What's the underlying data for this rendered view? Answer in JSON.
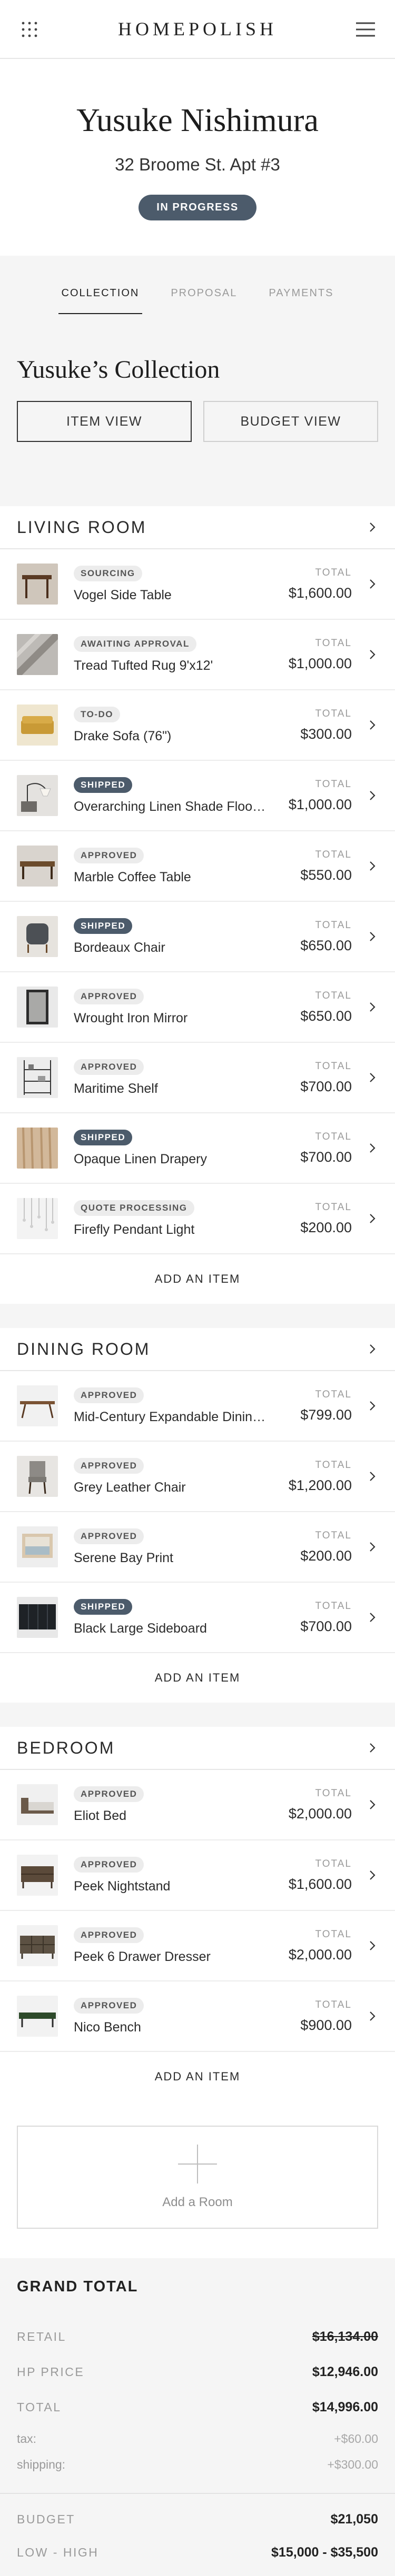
{
  "app": {
    "brand": "HOMEPOLISH"
  },
  "project": {
    "client_name": "Yusuke Nishimura",
    "address": "32 Broome St. Apt #3",
    "status": "IN PROGRESS"
  },
  "tabs": [
    {
      "label": "COLLECTION",
      "active": true
    },
    {
      "label": "PROPOSAL",
      "active": false
    },
    {
      "label": "PAYMENTS",
      "active": false
    }
  ],
  "collection": {
    "title": "Yusuke’s Collection",
    "item_view_label": "ITEM VIEW",
    "budget_view_label": "BUDGET VIEW"
  },
  "labels": {
    "total": "TOTAL",
    "add_item": "ADD AN ITEM",
    "add_room": "Add a Room"
  },
  "colors": {
    "status_badge": "#4c5b6b",
    "page_gray": "#f5f5f5",
    "light_badge": "#ececec"
  },
  "rooms": [
    {
      "name": "LIVING ROOM",
      "items": [
        {
          "status": "SOURCING",
          "name": "Vogel Side Table",
          "total": "$1,600.00",
          "thumb": "side-table"
        },
        {
          "status": "AWAITING APPROVAL",
          "name": "Tread Tufted Rug 9'x12'",
          "total": "$1,000.00",
          "thumb": "rug"
        },
        {
          "status": "TO-DO",
          "name": "Drake Sofa (76\")",
          "total": "$300.00",
          "thumb": "sofa"
        },
        {
          "status": "SHIPPED",
          "name": "Overarching Linen Shade Floor Lamp",
          "total": "$1,000.00",
          "thumb": "floor-lamp"
        },
        {
          "status": "APPROVED",
          "name": "Marble Coffee Table",
          "total": "$550.00",
          "thumb": "coffee-table"
        },
        {
          "status": "SHIPPED",
          "name": "Bordeaux Chair",
          "total": "$650.00",
          "thumb": "chair"
        },
        {
          "status": "APPROVED",
          "name": "Wrought Iron Mirror",
          "total": "$650.00",
          "thumb": "mirror"
        },
        {
          "status": "APPROVED",
          "name": "Maritime Shelf",
          "total": "$700.00",
          "thumb": "shelf"
        },
        {
          "status": "SHIPPED",
          "name": "Opaque Linen Drapery",
          "total": "$700.00",
          "thumb": "drapery"
        },
        {
          "status": "QUOTE PROCESSING",
          "name": "Firefly Pendant Light",
          "total": "$200.00",
          "thumb": "pendant"
        }
      ]
    },
    {
      "name": "DINING ROOM",
      "items": [
        {
          "status": "APPROVED",
          "name": "Mid-Century Expandable Dining Table",
          "total": "$799.00",
          "thumb": "dining-table"
        },
        {
          "status": "APPROVED",
          "name": "Grey Leather Chair",
          "total": "$1,200.00",
          "thumb": "leather-chair"
        },
        {
          "status": "APPROVED",
          "name": "Serene Bay Print",
          "total": "$200.00",
          "thumb": "print"
        },
        {
          "status": "SHIPPED",
          "name": "Black Large Sideboard",
          "total": "$700.00",
          "thumb": "sideboard"
        }
      ]
    },
    {
      "name": "BEDROOM",
      "items": [
        {
          "status": "APPROVED",
          "name": "Eliot Bed",
          "total": "$2,000.00",
          "thumb": "bed"
        },
        {
          "status": "APPROVED",
          "name": "Peek Nightstand",
          "total": "$1,600.00",
          "thumb": "nightstand"
        },
        {
          "status": "APPROVED",
          "name": "Peek 6 Drawer Dresser",
          "total": "$2,000.00",
          "thumb": "dresser"
        },
        {
          "status": "APPROVED",
          "name": "Nico Bench",
          "total": "$900.00",
          "thumb": "bench"
        }
      ]
    }
  ],
  "totals": {
    "title": "GRAND TOTAL",
    "rows": [
      {
        "label": "RETAIL",
        "value": "$16,134.00",
        "strike": true
      },
      {
        "label": "HP PRICE",
        "value": "$12,946.00"
      },
      {
        "label": "TOTAL",
        "value": "$14,996.00"
      }
    ],
    "small_rows": [
      {
        "label": "tax:",
        "value": "+$60.00"
      },
      {
        "label": "shipping:",
        "value": "+$300.00"
      }
    ],
    "budget_rows": [
      {
        "label": "BUDGET",
        "value": "$21,050"
      },
      {
        "label": "LOW - HIGH",
        "value": "$15,000 - $35,500"
      }
    ]
  }
}
